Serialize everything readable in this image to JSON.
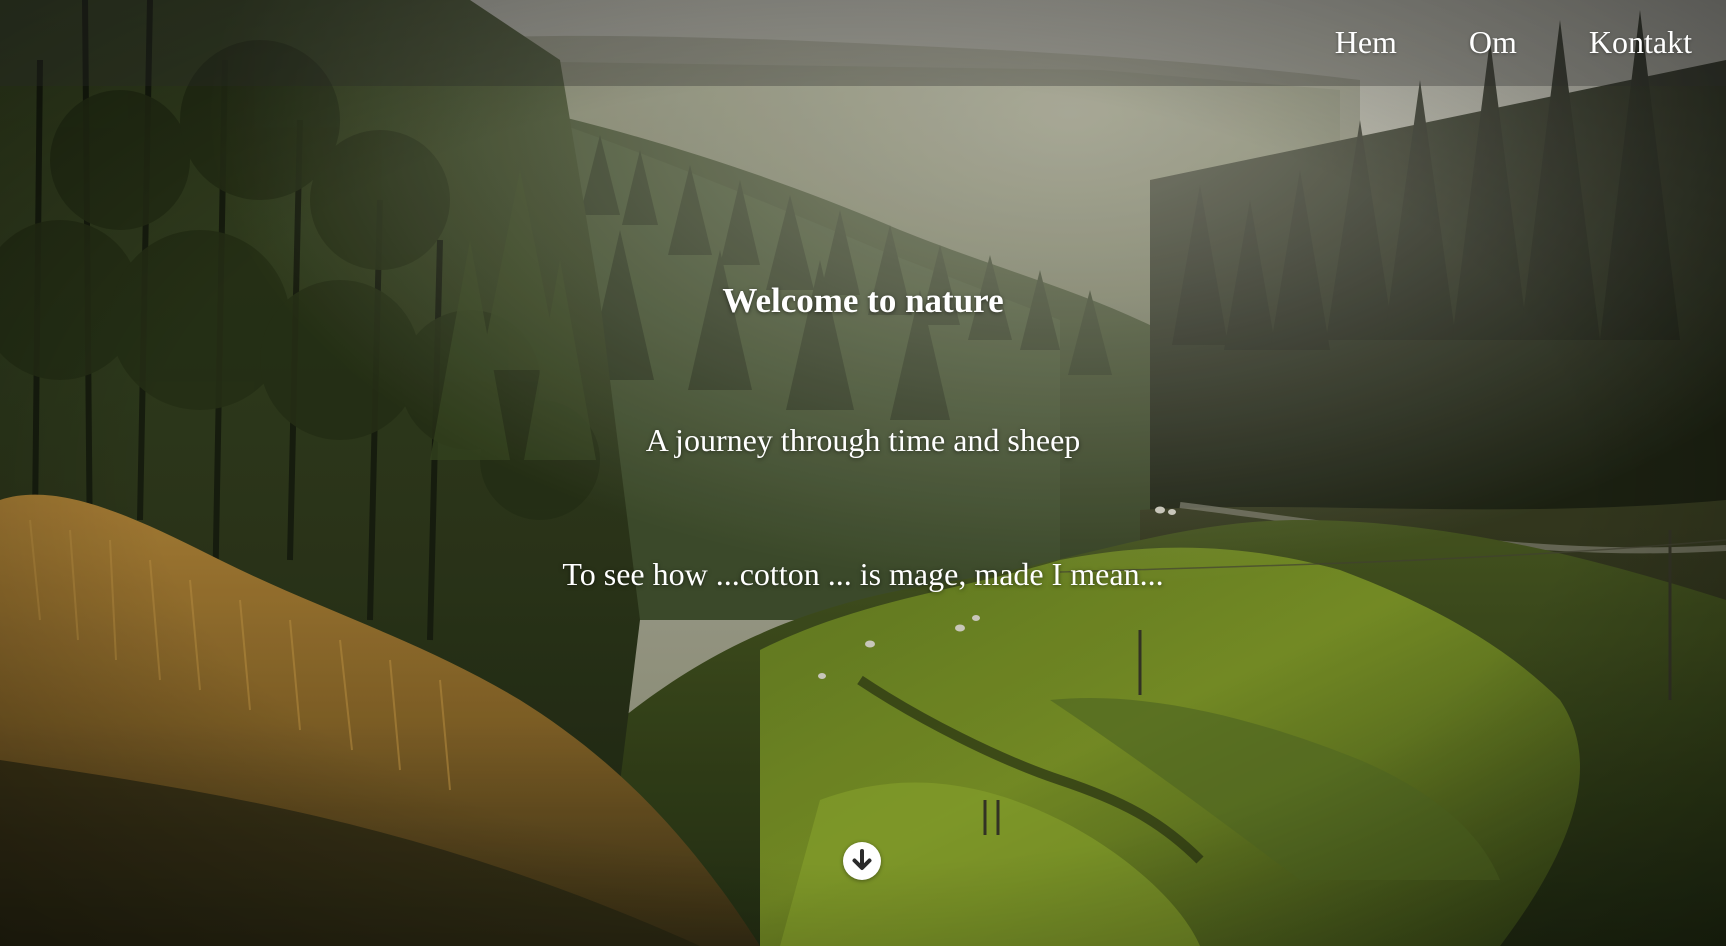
{
  "nav": {
    "items": [
      {
        "label": "Hem"
      },
      {
        "label": "Om"
      },
      {
        "label": "Kontakt"
      }
    ]
  },
  "hero": {
    "title": "Welcome to nature",
    "subtitle": "A journey through time and sheep",
    "tagline": "To see how ...cotton ... is mage, made I mean...",
    "background_image": "forest-valley-with-sheep-pasture",
    "scroll_icon": "arrow-down-circle-icon"
  },
  "colors": {
    "text": "#ffffff",
    "nav_bg": "rgba(40,40,40,0.32)",
    "scroll_button_bg": "#ffffff",
    "scroll_arrow": "#2b2b2b"
  }
}
